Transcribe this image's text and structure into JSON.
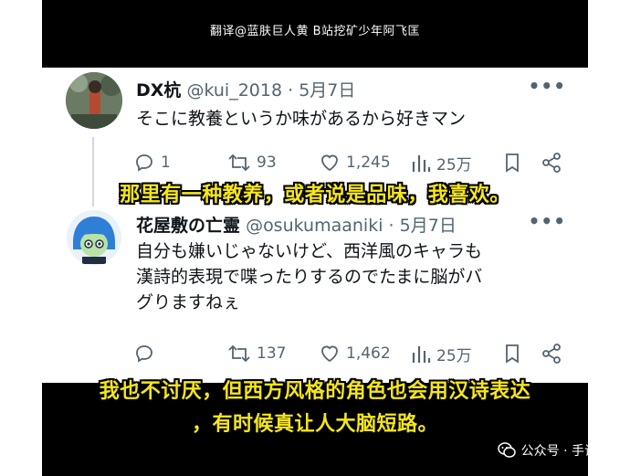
{
  "credit": "翻译@蓝肤巨人黄 B站挖矿少年阿飞匡",
  "tweets": [
    {
      "name": "DX杭",
      "handle": "@kui_2018",
      "date": "5月7日",
      "text": "そこに教養というか味があるから好きマン",
      "replies": "1",
      "retweets": "93",
      "likes": "1,245",
      "views": "25万"
    },
    {
      "name": "花屋敷の亡霊",
      "handle": "@osukumaaniki",
      "date": "5月7日",
      "text_lines": [
        "自分も嫌いじゃないけど、西洋風のキャラも",
        "漢詩的表現で喋ったりするのでたまに脳がバ",
        "グりますねぇ"
      ],
      "replies": "",
      "retweets": "137",
      "likes": "1,462",
      "views": "25万"
    }
  ],
  "subtitles": [
    "那里有一种教养，或者说是品味，我喜欢。",
    "我也不讨厌，但西方风格的角色也会用汉诗表达",
    "，有时候真让人大脑短路。"
  ],
  "watermark": "公众号 · 手谈姬",
  "icons": {
    "reply": "reply-icon",
    "retweet": "retweet-icon",
    "like": "heart-icon",
    "views": "views-icon",
    "bookmark": "bookmark-icon",
    "share": "share-icon",
    "more": "more-icon",
    "wechat": "wechat-icon"
  },
  "colors": {
    "subtitle": "#f5e61a",
    "text_primary": "#0f1419",
    "text_secondary": "#536471"
  }
}
